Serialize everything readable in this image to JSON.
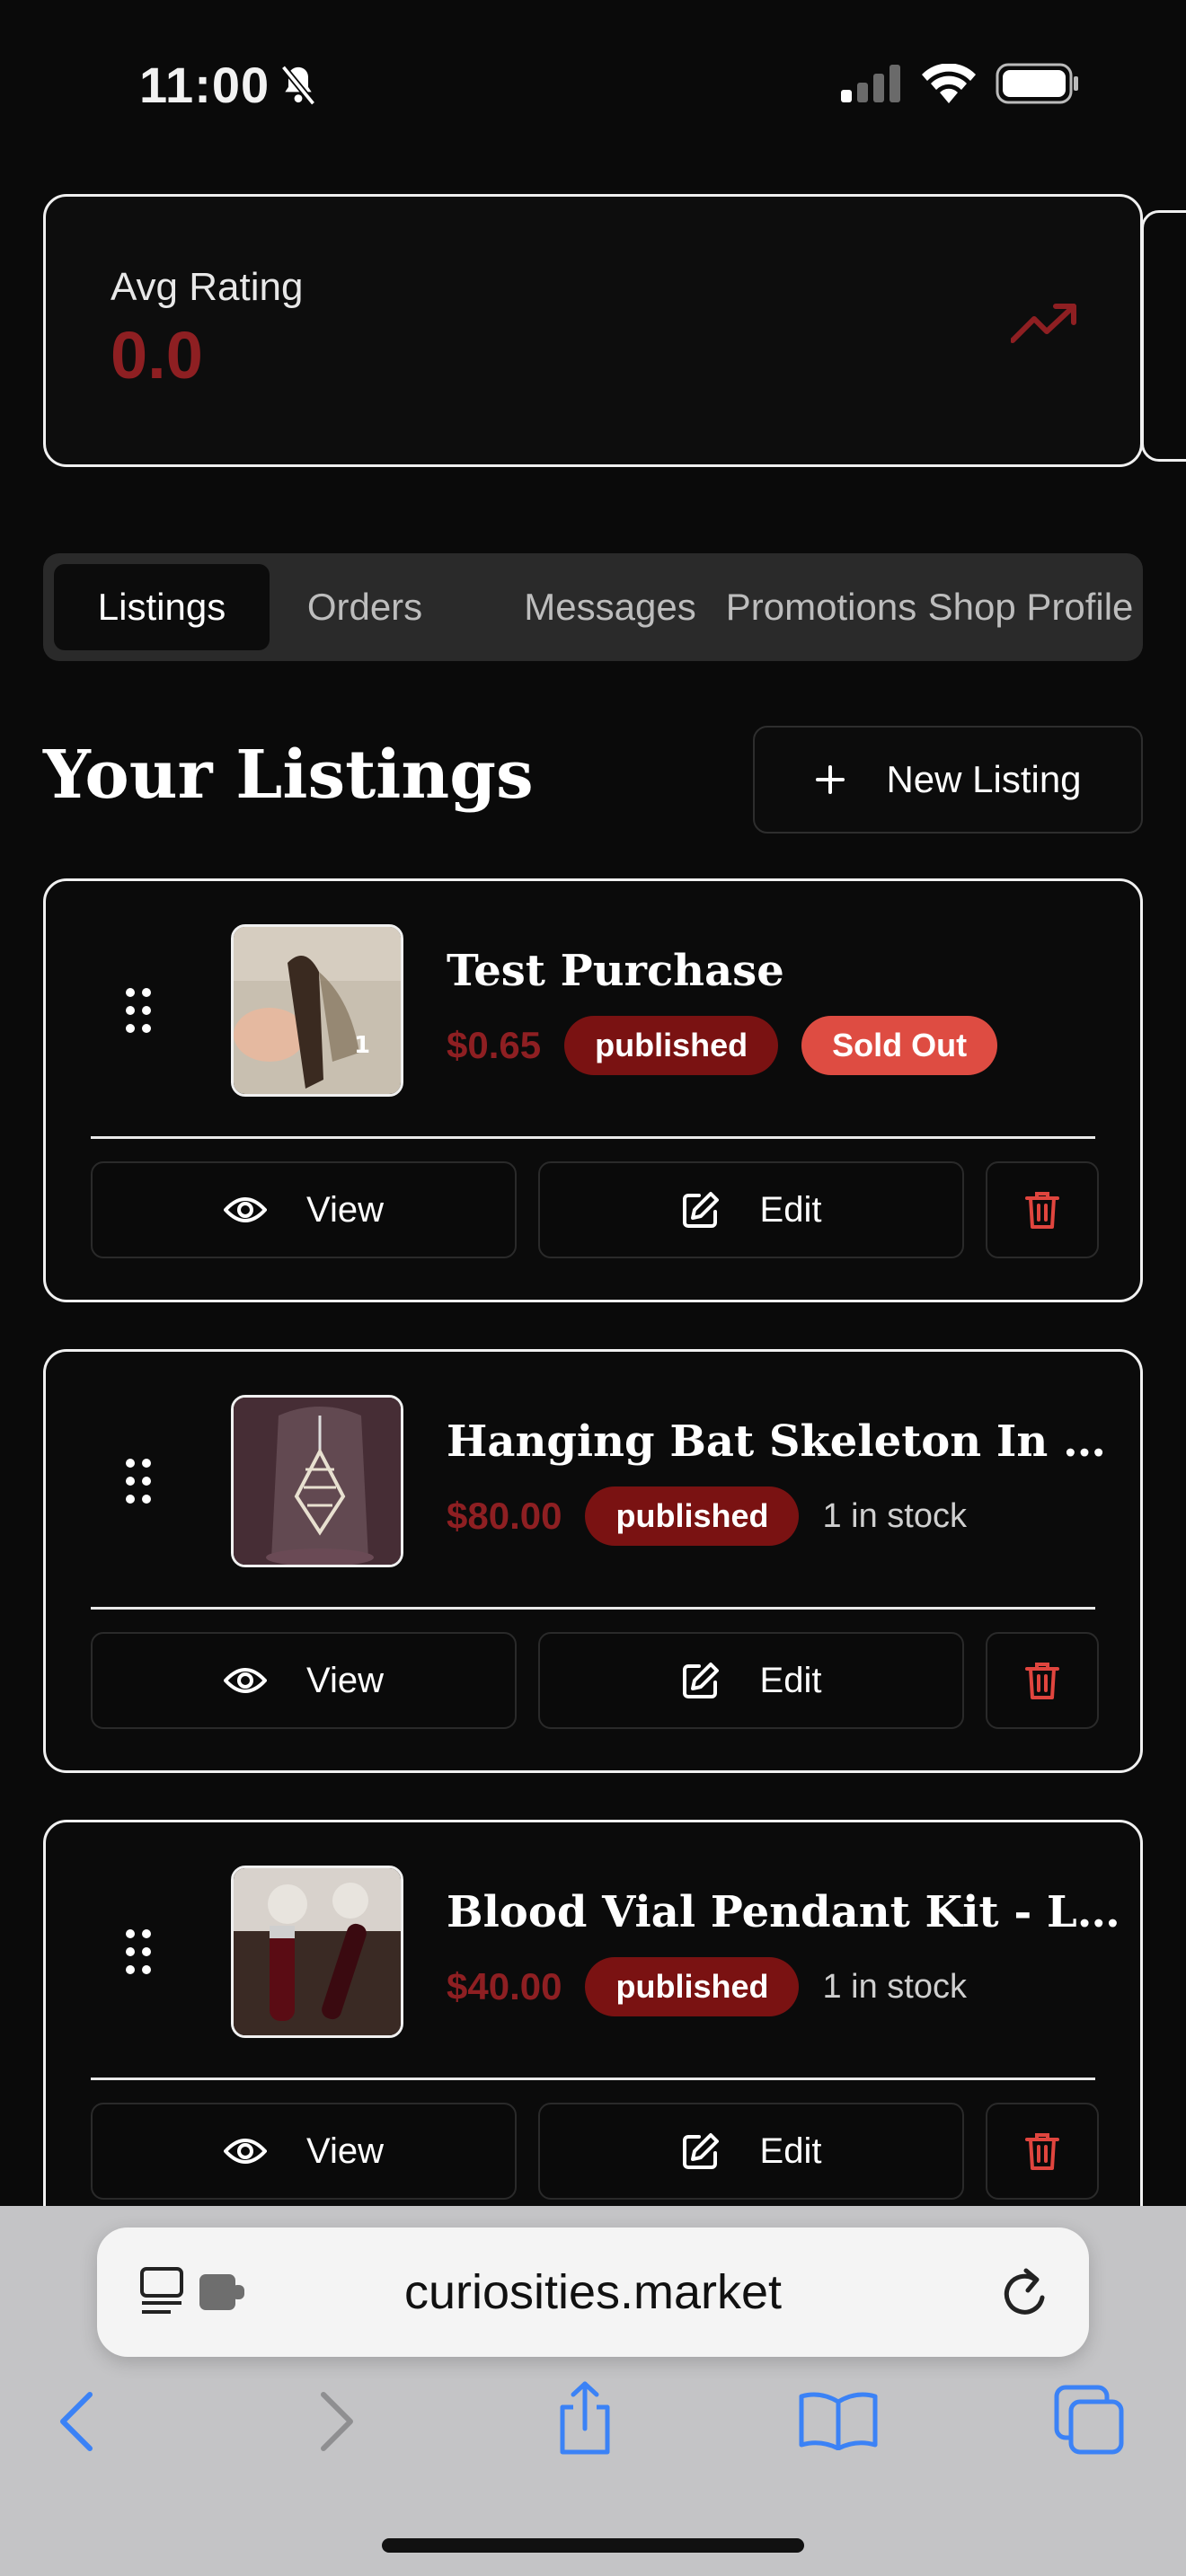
{
  "status_bar": {
    "time": "11:00"
  },
  "stats": {
    "avg_rating_label": "Avg Rating",
    "avg_rating_value": "0.0"
  },
  "tabs": [
    {
      "label": "Listings",
      "active": true
    },
    {
      "label": "Orders",
      "active": false
    },
    {
      "label": "Messages",
      "active": false
    },
    {
      "label": "Promotions",
      "active": false
    },
    {
      "label": "Shop Profile",
      "active": false
    }
  ],
  "section": {
    "title": "Your Listings",
    "new_listing_label": "New Listing"
  },
  "listings": [
    {
      "title": "Test Purchase",
      "price": "$0.65",
      "status": "published",
      "extra_badge": "Sold Out",
      "stock": ""
    },
    {
      "title": "Hanging Bat Skeleton In a Glas...",
      "price": "$80.00",
      "status": "published",
      "extra_badge": "",
      "stock": "1 in stock"
    },
    {
      "title": "Blood Vial Pendant Kit - Lover...",
      "price": "$40.00",
      "status": "published",
      "extra_badge": "",
      "stock": "1 in stock"
    }
  ],
  "actions": {
    "view_label": "View",
    "edit_label": "Edit"
  },
  "browser": {
    "url": "curiosities.market"
  },
  "colors": {
    "accent_red": "#8e1f22",
    "badge_published": "#7a1212",
    "badge_sold_out": "#de4c42",
    "delete_icon": "#e0453e",
    "browser_blue": "#3b82f6"
  }
}
